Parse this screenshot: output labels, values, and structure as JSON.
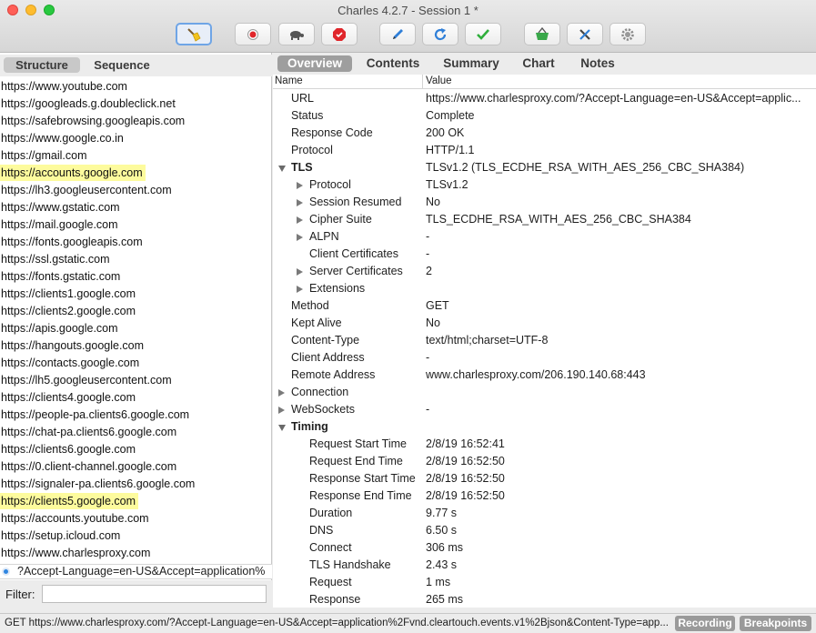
{
  "window": {
    "title": "Charles 4.2.7 - Session 1 *"
  },
  "toolbar": {
    "buttons": [
      {
        "name": "broom-icon",
        "active": true
      },
      {
        "name": "record-icon"
      },
      {
        "name": "throttle-turtle-icon"
      },
      {
        "name": "breakpoint-stop-icon"
      },
      {
        "name": "compose-pencil-icon"
      },
      {
        "name": "repeat-icon"
      },
      {
        "name": "validate-check-icon"
      },
      {
        "name": "basket-icon"
      },
      {
        "name": "tools-icon"
      },
      {
        "name": "settings-gear-icon"
      }
    ]
  },
  "left": {
    "tabs": [
      {
        "label": "Structure",
        "selected": true
      },
      {
        "label": "Sequence",
        "selected": false
      }
    ],
    "hosts": [
      {
        "label": "https://www.youtube.com",
        "highlight": false
      },
      {
        "label": "https://googleads.g.doubleclick.net",
        "highlight": false
      },
      {
        "label": "https://safebrowsing.googleapis.com",
        "highlight": false
      },
      {
        "label": "https://www.google.co.in",
        "highlight": false
      },
      {
        "label": "https://gmail.com",
        "highlight": false
      },
      {
        "label": "https://accounts.google.com",
        "highlight": true
      },
      {
        "label": "https://lh3.googleusercontent.com",
        "highlight": false
      },
      {
        "label": "https://www.gstatic.com",
        "highlight": false
      },
      {
        "label": "https://mail.google.com",
        "highlight": false
      },
      {
        "label": "https://fonts.googleapis.com",
        "highlight": false
      },
      {
        "label": "https://ssl.gstatic.com",
        "highlight": false
      },
      {
        "label": "https://fonts.gstatic.com",
        "highlight": false
      },
      {
        "label": "https://clients1.google.com",
        "highlight": false
      },
      {
        "label": "https://clients2.google.com",
        "highlight": false
      },
      {
        "label": "https://apis.google.com",
        "highlight": false
      },
      {
        "label": "https://hangouts.google.com",
        "highlight": false
      },
      {
        "label": "https://contacts.google.com",
        "highlight": false
      },
      {
        "label": "https://lh5.googleusercontent.com",
        "highlight": false
      },
      {
        "label": "https://clients4.google.com",
        "highlight": false
      },
      {
        "label": "https://people-pa.clients6.google.com",
        "highlight": false
      },
      {
        "label": "https://chat-pa.clients6.google.com",
        "highlight": false
      },
      {
        "label": "https://clients6.google.com",
        "highlight": false
      },
      {
        "label": "https://0.client-channel.google.com",
        "highlight": false
      },
      {
        "label": "https://signaler-pa.clients6.google.com",
        "highlight": false
      },
      {
        "label": "https://clients5.google.com",
        "highlight": true
      },
      {
        "label": "https://accounts.youtube.com",
        "highlight": false
      },
      {
        "label": "https://setup.icloud.com",
        "highlight": false
      },
      {
        "label": "https://www.charlesproxy.com",
        "highlight": false
      }
    ],
    "selected_request": "?Accept-Language=en-US&Accept=application%",
    "filter": {
      "label": "Filter:",
      "value": ""
    }
  },
  "right": {
    "tabs": [
      {
        "label": "Overview",
        "selected": true
      },
      {
        "label": "Contents",
        "selected": false
      },
      {
        "label": "Summary",
        "selected": false
      },
      {
        "label": "Chart",
        "selected": false
      },
      {
        "label": "Notes",
        "selected": false
      }
    ],
    "columns": {
      "name": "Name",
      "value": "Value"
    },
    "rows": [
      {
        "name": "URL",
        "value": "https://www.charlesproxy.com/?Accept-Language=en-US&Accept=applic...",
        "indent": 1,
        "toggle": "none",
        "bold": false
      },
      {
        "name": "Status",
        "value": "Complete",
        "indent": 1,
        "toggle": "none",
        "bold": false
      },
      {
        "name": "Response Code",
        "value": "200 OK",
        "indent": 1,
        "toggle": "none",
        "bold": false
      },
      {
        "name": "Protocol",
        "value": "HTTP/1.1",
        "indent": 1,
        "toggle": "none",
        "bold": false
      },
      {
        "name": "TLS",
        "value": "TLSv1.2 (TLS_ECDHE_RSA_WITH_AES_256_CBC_SHA384)",
        "indent": 1,
        "toggle": "expanded",
        "bold": true
      },
      {
        "name": "Protocol",
        "value": "TLSv1.2",
        "indent": 2,
        "toggle": "collapsed",
        "bold": false
      },
      {
        "name": "Session Resumed",
        "value": "No",
        "indent": 2,
        "toggle": "collapsed",
        "bold": false
      },
      {
        "name": "Cipher Suite",
        "value": "TLS_ECDHE_RSA_WITH_AES_256_CBC_SHA384",
        "indent": 2,
        "toggle": "collapsed",
        "bold": false
      },
      {
        "name": "ALPN",
        "value": "-",
        "indent": 2,
        "toggle": "collapsed",
        "bold": false
      },
      {
        "name": "Client Certificates",
        "value": "-",
        "indent": 2,
        "toggle": "none",
        "bold": false
      },
      {
        "name": "Server Certificates",
        "value": "2",
        "indent": 2,
        "toggle": "collapsed",
        "bold": false
      },
      {
        "name": "Extensions",
        "value": "",
        "indent": 2,
        "toggle": "collapsed",
        "bold": false
      },
      {
        "name": "Method",
        "value": "GET",
        "indent": 1,
        "toggle": "none",
        "bold": false
      },
      {
        "name": "Kept Alive",
        "value": "No",
        "indent": 1,
        "toggle": "none",
        "bold": false
      },
      {
        "name": "Content-Type",
        "value": "text/html;charset=UTF-8",
        "indent": 1,
        "toggle": "none",
        "bold": false
      },
      {
        "name": "Client Address",
        "value": "-",
        "indent": 1,
        "toggle": "none",
        "bold": false
      },
      {
        "name": "Remote Address",
        "value": "www.charlesproxy.com/206.190.140.68:443",
        "indent": 1,
        "toggle": "none",
        "bold": false
      },
      {
        "name": "Connection",
        "value": "",
        "indent": 1,
        "toggle": "collapsed",
        "bold": false
      },
      {
        "name": "WebSockets",
        "value": "-",
        "indent": 1,
        "toggle": "collapsed",
        "bold": false
      },
      {
        "name": "Timing",
        "value": "",
        "indent": 1,
        "toggle": "expanded",
        "bold": true
      },
      {
        "name": "Request Start Time",
        "value": "2/8/19 16:52:41",
        "indent": 2,
        "toggle": "none",
        "bold": false
      },
      {
        "name": "Request End Time",
        "value": "2/8/19 16:52:50",
        "indent": 2,
        "toggle": "none",
        "bold": false
      },
      {
        "name": "Response Start Time",
        "value": "2/8/19 16:52:50",
        "indent": 2,
        "toggle": "none",
        "bold": false
      },
      {
        "name": "Response End Time",
        "value": "2/8/19 16:52:50",
        "indent": 2,
        "toggle": "none",
        "bold": false
      },
      {
        "name": "Duration",
        "value": "9.77 s",
        "indent": 2,
        "toggle": "none",
        "bold": false
      },
      {
        "name": "DNS",
        "value": "6.50 s",
        "indent": 2,
        "toggle": "none",
        "bold": false
      },
      {
        "name": "Connect",
        "value": "306 ms",
        "indent": 2,
        "toggle": "none",
        "bold": false
      },
      {
        "name": "TLS Handshake",
        "value": "2.43 s",
        "indent": 2,
        "toggle": "none",
        "bold": false
      },
      {
        "name": "Request",
        "value": "1 ms",
        "indent": 2,
        "toggle": "none",
        "bold": false
      },
      {
        "name": "Response",
        "value": "265 ms",
        "indent": 2,
        "toggle": "none",
        "bold": false
      }
    ]
  },
  "statusbar": {
    "text": "GET https://www.charlesproxy.com/?Accept-Language=en-US&Accept=application%2Fvnd.cleartouch.events.v1%2Bjson&Content-Type=app...",
    "recording_label": "Recording",
    "breakpoints_label": "Breakpoints"
  },
  "colors": {
    "highlight": "#fdfb9d",
    "selected_tab": "#9e9e9e",
    "focus_ring": "#6fa5e6"
  }
}
